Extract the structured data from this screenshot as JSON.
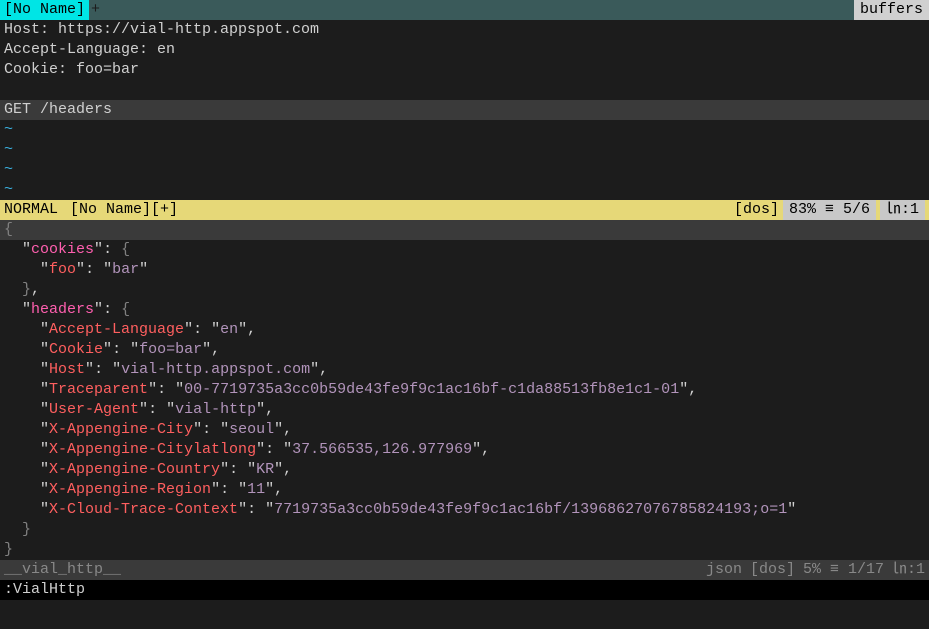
{
  "topbar": {
    "left_label": "[No Name]",
    "plus": "+",
    "right_label": "buffers"
  },
  "editor_top": {
    "lines": [
      "Host: https://vial-http.appspot.com",
      "Accept-Language: en",
      "Cookie: foo=bar"
    ],
    "cursor_line": "GET /headers"
  },
  "tildes": [
    "~",
    "~",
    "~",
    "~"
  ],
  "status1": {
    "mode": " NORMAL ",
    "filename": "[No Name][+]",
    "dos": "[dos]",
    "percent": "83% ≡ 5/6",
    "lncol": "㏑:1 "
  },
  "json_response": {
    "open_brace": "{",
    "cookies_key": "cookies",
    "cookies_open": "{",
    "foo_key": "foo",
    "foo_val": "bar",
    "cookies_close": "}",
    "headers_key": "headers",
    "headers_open": "{",
    "entries": [
      {
        "k": "Accept-Language",
        "v": "en"
      },
      {
        "k": "Cookie",
        "v": "foo=bar"
      },
      {
        "k": "Host",
        "v": "vial-http.appspot.com"
      },
      {
        "k": "Traceparent",
        "v": "00-7719735a3cc0b59de43fe9f9c1ac16bf-c1da88513fb8e1c1-01"
      },
      {
        "k": "User-Agent",
        "v": "vial-http"
      },
      {
        "k": "X-Appengine-City",
        "v": "seoul"
      },
      {
        "k": "X-Appengine-Citylatlong",
        "v": "37.566535,126.977969"
      },
      {
        "k": "X-Appengine-Country",
        "v": "KR"
      },
      {
        "k": "X-Appengine-Region",
        "v": "11"
      },
      {
        "k": "X-Cloud-Trace-Context",
        "v": "7719735a3cc0b59de43fe9f9c1ac16bf/13968627076785824193;o=1"
      }
    ],
    "headers_close": "}",
    "close_brace": "}"
  },
  "status2": {
    "filename": "__vial_http__",
    "filetype": "json",
    "dos": "[dos]",
    "percent": "5% ≡ 1/17",
    "lncol": "㏑:1 "
  },
  "cmdline": ":VialHttp"
}
